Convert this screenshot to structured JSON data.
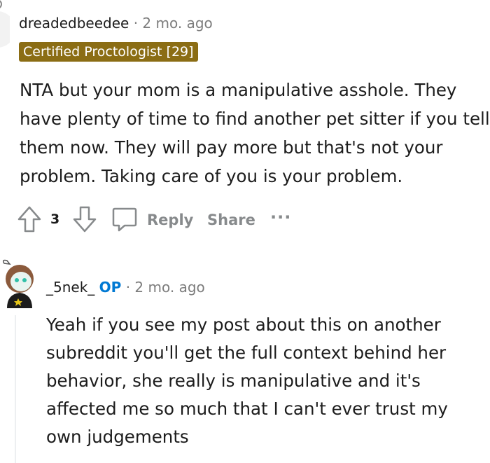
{
  "comment1": {
    "username": "dreadedbeedee",
    "separator": "·",
    "time": "2 mo. ago",
    "flair": {
      "text": "Certified Proctologist [29]",
      "bg": "#8b6d14",
      "color": "#ffffff"
    },
    "body": "NTA but your mom is a manipulative asshole. They have plenty of time to find another pet sitter if you tell them now. They will pay more but that's not your problem. Taking care of you is your problem.",
    "actions": {
      "score": "3",
      "reply_label": "Reply",
      "share_label": "Share",
      "more_label": "···"
    }
  },
  "comment2": {
    "username": "_5nek_",
    "op_badge": "OP",
    "separator": "·",
    "time": "2 mo. ago",
    "body": "Yeah if you see my post about this on another subreddit you'll get the full context behind her behavior, she really is manipulative and it's affected me so much that I can't ever trust my own judgements"
  },
  "colors": {
    "meta_gray": "#7c7c7c",
    "op_blue": "#0079d3",
    "action_gray": "#878a8c",
    "text": "#1c1c1c"
  },
  "icons": [
    "avatar",
    "upvote-icon",
    "downvote-icon",
    "comment-icon",
    "more-icon"
  ]
}
